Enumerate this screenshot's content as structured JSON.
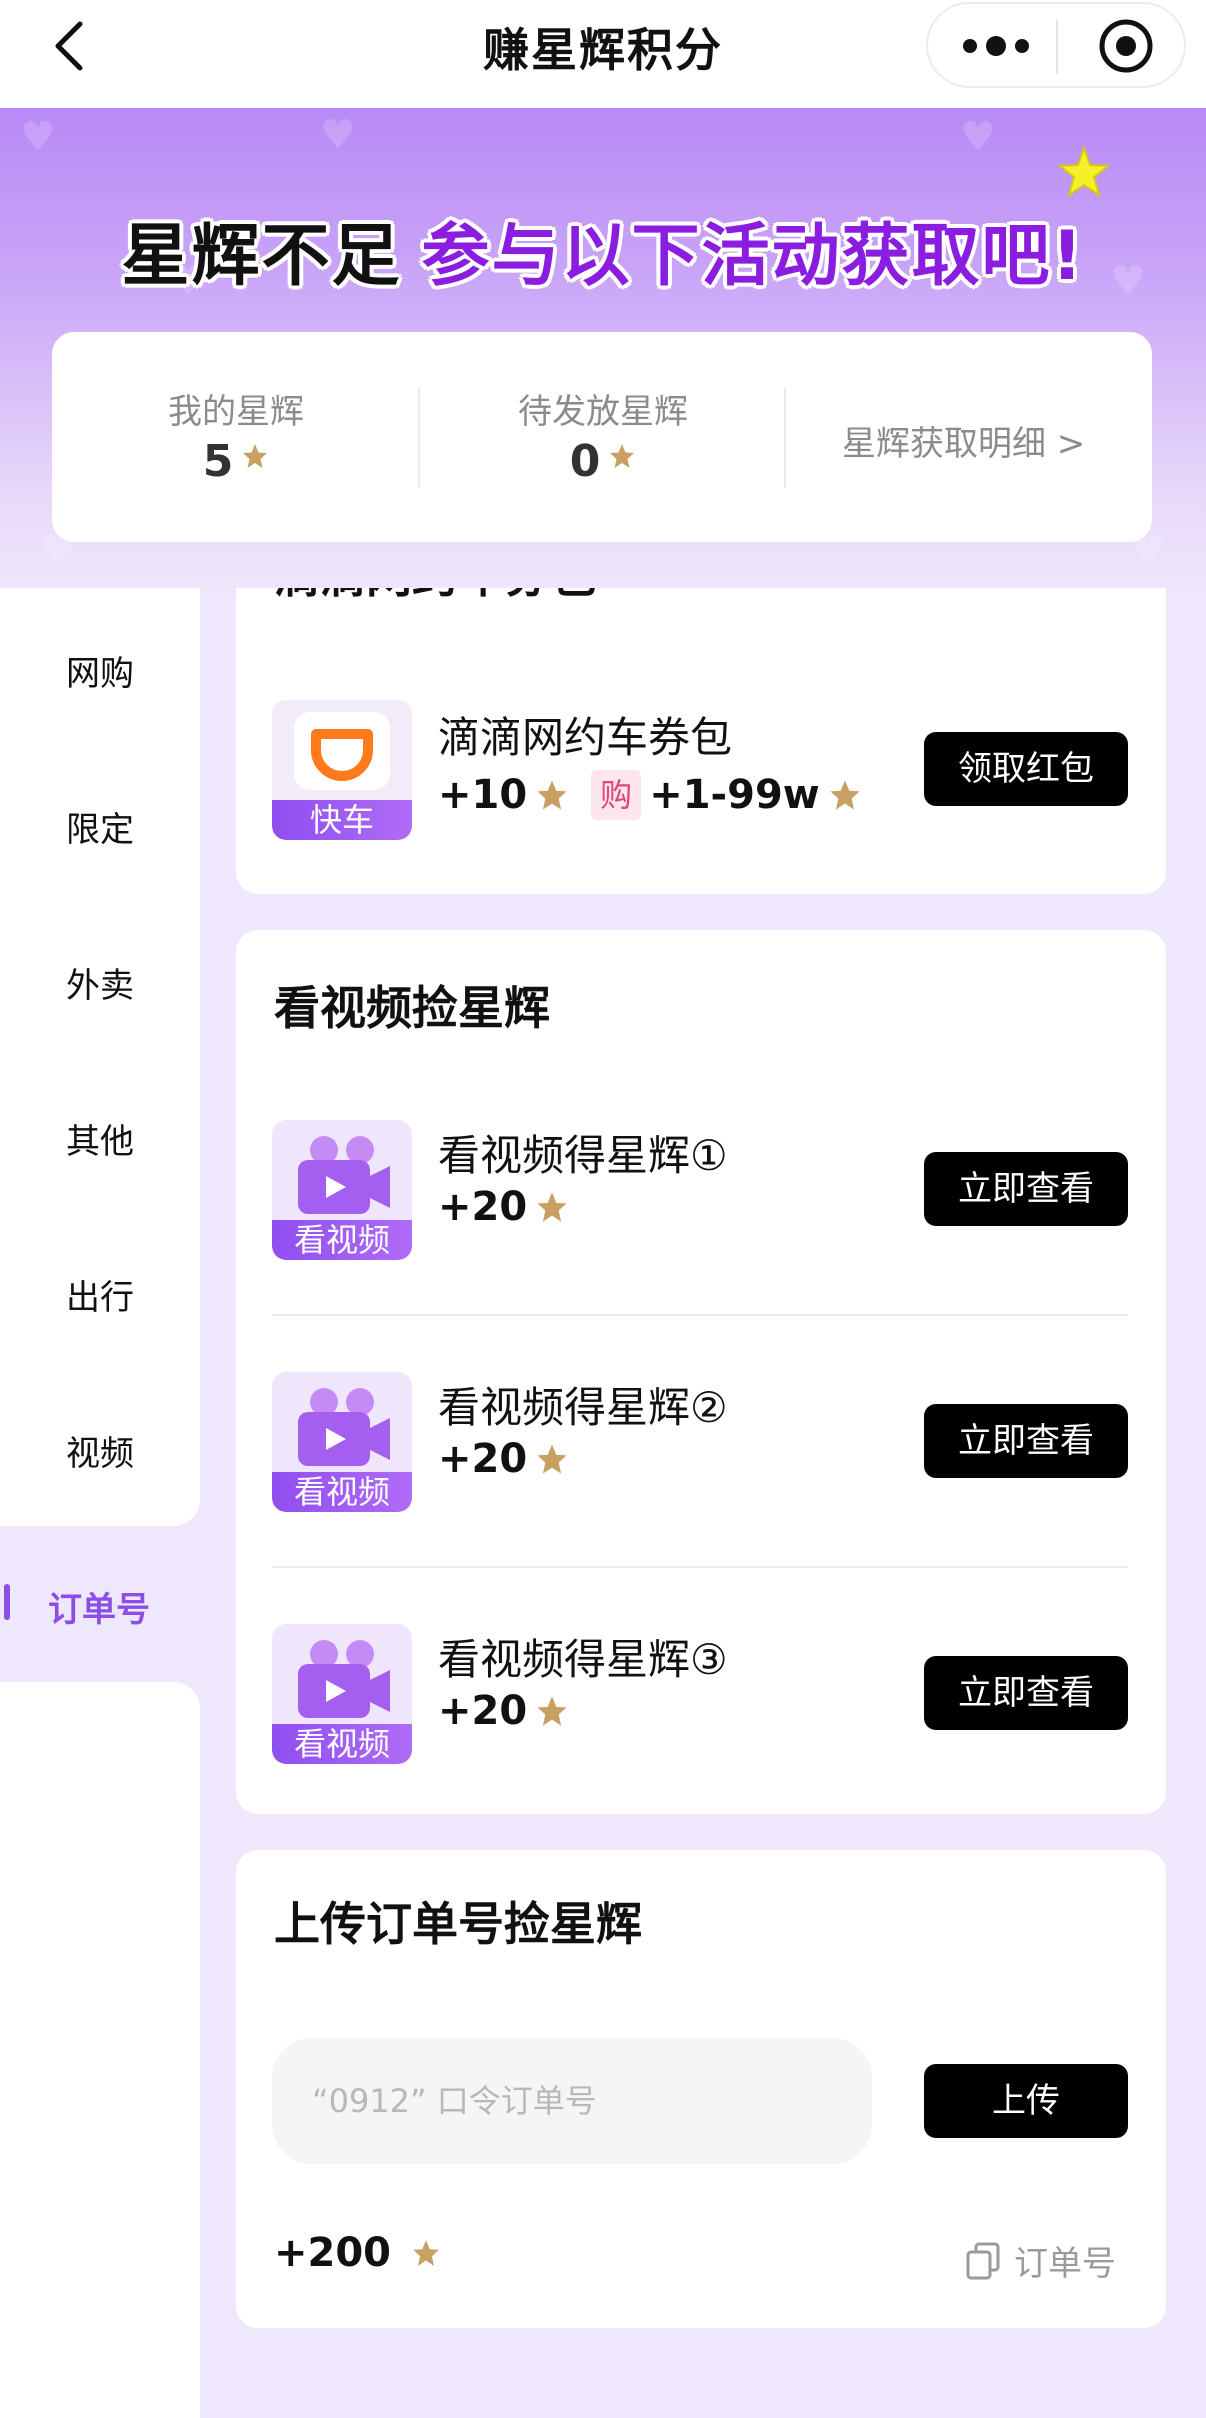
{
  "nav": {
    "title": "赚星辉积分"
  },
  "hero": {
    "banner_part1": "星辉不足",
    "banner_part2": "参与以下活动获取吧!"
  },
  "stats": {
    "my_label": "我的星辉",
    "my_value": "5",
    "pending_label": "待发放星辉",
    "pending_value": "0",
    "detail_link": "星辉获取明细 >"
  },
  "sidebar": {
    "items": [
      {
        "label": "网购"
      },
      {
        "label": "限定"
      },
      {
        "label": "外卖"
      },
      {
        "label": "其他"
      },
      {
        "label": "出行"
      },
      {
        "label": "视频"
      },
      {
        "label": "订单号",
        "active": true
      }
    ]
  },
  "travel": {
    "title_partial": "滴滴网约车券包",
    "task": {
      "icon_tag": "快车",
      "name": "滴滴网约车券包",
      "reward": "+10",
      "buy_tag": "购",
      "buy_reward": "+1-99w",
      "button": "领取红包"
    }
  },
  "video": {
    "title": "看视频捡星辉",
    "tasks": [
      {
        "icon_tag": "看视频",
        "name": "看视频得星辉①",
        "reward": "+20",
        "button": "立即查看"
      },
      {
        "icon_tag": "看视频",
        "name": "看视频得星辉②",
        "reward": "+20",
        "button": "立即查看"
      },
      {
        "icon_tag": "看视频",
        "name": "看视频得星辉③",
        "reward": "+20",
        "button": "立即查看"
      }
    ]
  },
  "order": {
    "title": "上传订单号捡星辉",
    "placeholder": "“0912” 口令订单号",
    "upload_button": "上传",
    "bonus": "+200",
    "link": "订单号"
  },
  "colors": {
    "accent_purple": "#8b4fe6",
    "banner_purple": "#8a1de0",
    "star_gold": "#c9a063",
    "button_black": "#000000"
  }
}
